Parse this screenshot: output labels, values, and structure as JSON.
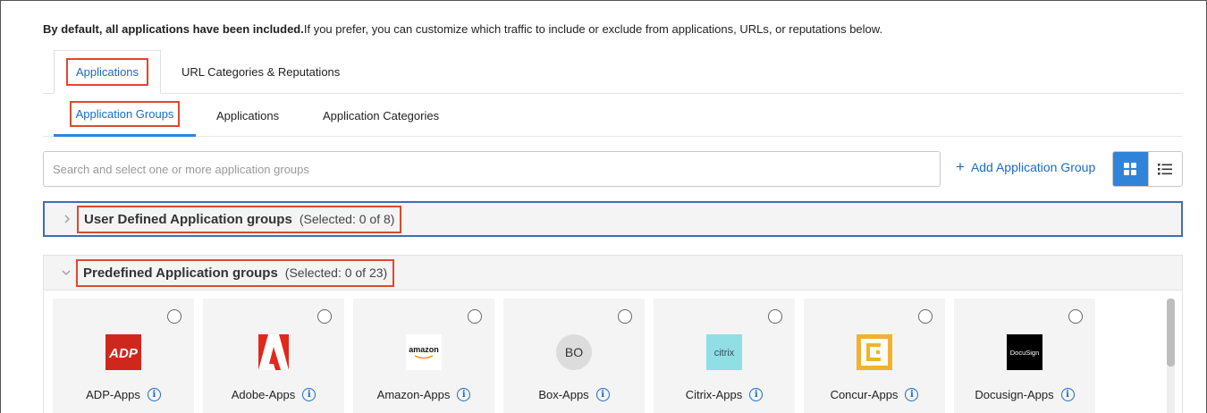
{
  "intro": {
    "bold": "By default, all applications have been included.",
    "rest": "If you prefer, you can customize which traffic to include or exclude from applications, URLs, or reputations below."
  },
  "main_tabs": [
    {
      "label": "Applications",
      "active": true
    },
    {
      "label": "URL Categories & Reputations",
      "active": false
    }
  ],
  "sub_tabs": [
    {
      "label": "Application Groups",
      "active": true
    },
    {
      "label": "Applications",
      "active": false
    },
    {
      "label": "Application Categories",
      "active": false
    }
  ],
  "search": {
    "placeholder": "Search and select one or more application groups"
  },
  "add_group": {
    "label": "Add Application Group"
  },
  "view_toggle": {
    "selected": "grid",
    "options": [
      "grid-view-icon",
      "list-view-icon"
    ]
  },
  "sections": {
    "user": {
      "title": "User Defined Application groups",
      "count": "(Selected: 0 of 8)",
      "expanded": false
    },
    "predefined": {
      "title": "Predefined Application groups",
      "count": "(Selected: 0 of 23)",
      "expanded": true
    }
  },
  "cards": [
    {
      "name": "ADP-Apps",
      "logo": "adp-logo",
      "logo_text": "ADP"
    },
    {
      "name": "Adobe-Apps",
      "logo": "adobe-logo"
    },
    {
      "name": "Amazon-Apps",
      "logo": "amazon-logo",
      "logo_text": "amazon"
    },
    {
      "name": "Box-Apps",
      "logo": "box-logo",
      "logo_text": "BO"
    },
    {
      "name": "Citrix-Apps",
      "logo": "citrix-logo",
      "logo_text": "citrix"
    },
    {
      "name": "Concur-Apps",
      "logo": "concur-logo"
    },
    {
      "name": "Docusign-Apps",
      "logo": "docusign-logo",
      "logo_text": "DocuSign"
    }
  ],
  "colors": {
    "accent": "#2f84da",
    "link": "#1b6ac9",
    "highlight": "#e0482f",
    "adp_red": "#d0271d",
    "citrix_teal": "#8fdfe4",
    "concur_yellow": "#f3b12d"
  }
}
